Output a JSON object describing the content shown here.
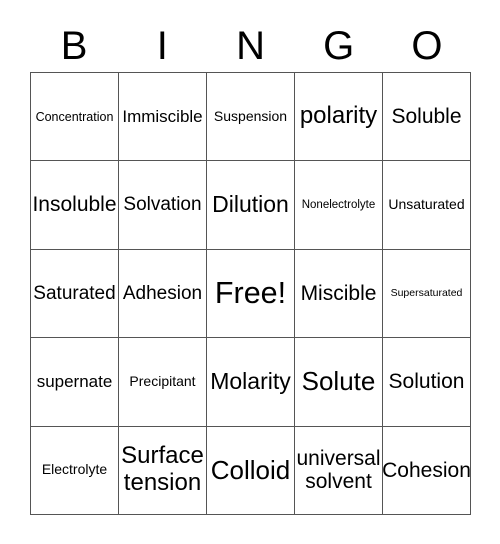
{
  "card": {
    "title_letters": [
      "B",
      "I",
      "N",
      "G",
      "O"
    ],
    "grid": {
      "rows": 5,
      "columns": 5,
      "border_color": "#555555",
      "background_color": "#ffffff",
      "text_color": "#000000"
    },
    "cells": [
      [
        {
          "label": "Concentration",
          "size": "fs-12"
        },
        {
          "label": "Immiscible",
          "size": "fs-17"
        },
        {
          "label": "Suspension",
          "size": "fs-14"
        },
        {
          "label": "polarity",
          "size": "fs-24"
        },
        {
          "label": "Soluble",
          "size": "fs-21"
        }
      ],
      [
        {
          "label": "Insoluble",
          "size": "fs-21"
        },
        {
          "label": "Solvation",
          "size": "fs-19"
        },
        {
          "label": "Dilution",
          "size": "fs-23"
        },
        {
          "label": "Nonelectrolyte",
          "size": "fs-11"
        },
        {
          "label": "Unsaturated",
          "size": "fs-14"
        }
      ],
      [
        {
          "label": "Saturated",
          "size": "fs-19"
        },
        {
          "label": "Adhesion",
          "size": "fs-19"
        },
        {
          "label": "Free!",
          "size": "fs-30"
        },
        {
          "label": "Miscible",
          "size": "fs-21"
        },
        {
          "label": "Supersaturated",
          "size": "fs-10"
        }
      ],
      [
        {
          "label": "supernate",
          "size": "fs-17"
        },
        {
          "label": "Precipitant",
          "size": "fs-14"
        },
        {
          "label": "Molarity",
          "size": "fs-23"
        },
        {
          "label": "Solute",
          "size": "fs-26"
        },
        {
          "label": "Solution",
          "size": "fs-21"
        }
      ],
      [
        {
          "label": "Electrolyte",
          "size": "fs-14"
        },
        {
          "label": "Surface tension",
          "size": "fs-24"
        },
        {
          "label": "Colloid",
          "size": "fs-26"
        },
        {
          "label": "universal solvent",
          "size": "fs-21"
        },
        {
          "label": "Cohesion",
          "size": "fs-21"
        }
      ]
    ]
  }
}
